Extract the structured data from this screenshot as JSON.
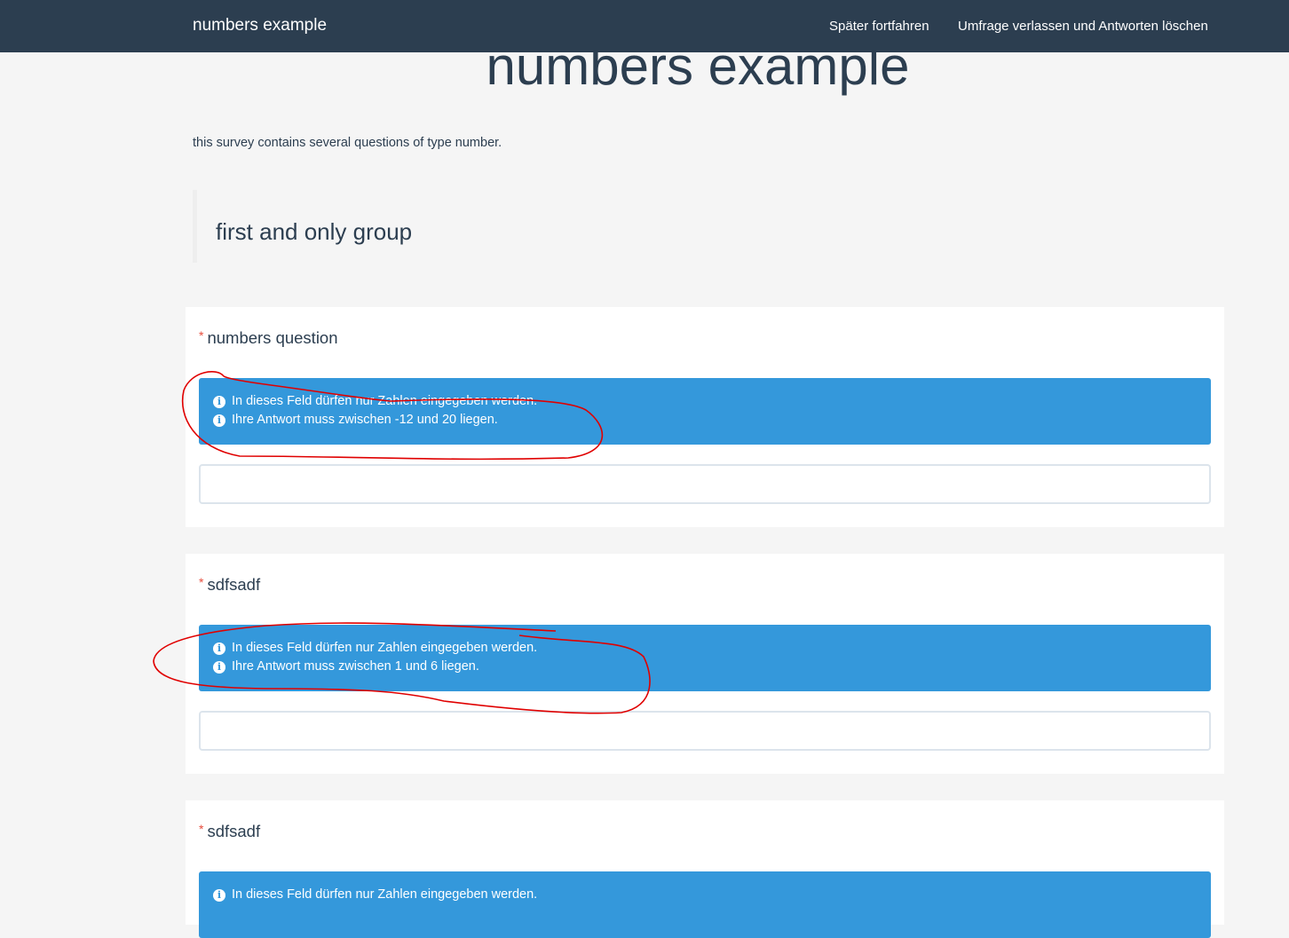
{
  "navbar": {
    "brand": "numbers example",
    "links": [
      "Später fortfahren",
      "Umfrage verlassen und Antworten löschen"
    ]
  },
  "page": {
    "title": "numbers example",
    "description": "this survey contains several questions of type number.",
    "group_title": "first and only group"
  },
  "questions": [
    {
      "required": "*",
      "title": "numbers question",
      "help": [
        "In dieses Feld dürfen nur Zahlen eingegeben werden.",
        "Ihre Antwort muss zwischen -12 und 20 liegen."
      ],
      "value": ""
    },
    {
      "required": "*",
      "title": "sdfsadf",
      "help": [
        "In dieses Feld dürfen nur Zahlen eingegeben werden.",
        "Ihre Antwort muss zwischen 1 und 6 liegen."
      ],
      "value": ""
    },
    {
      "required": "*",
      "title": "sdfsadf",
      "help": [
        "In dieses Feld dürfen nur Zahlen eingegeben werden."
      ]
    }
  ],
  "colors": {
    "navbar": "#2c3e50",
    "alert": "#3498db",
    "required": "#e74c3c",
    "annotation": "#e00000"
  }
}
